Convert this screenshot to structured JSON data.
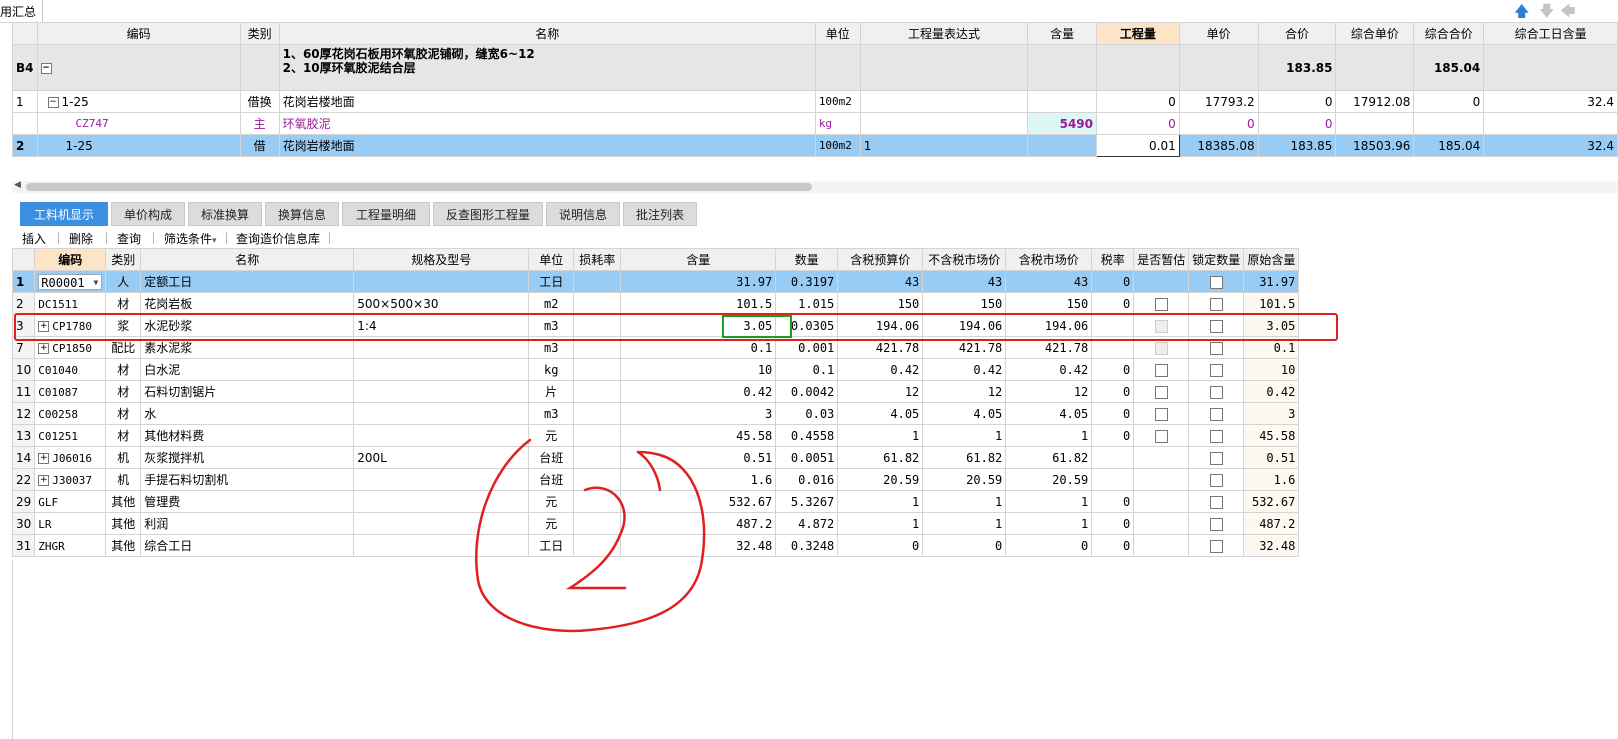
{
  "topbar": {
    "label": "用汇总"
  },
  "upper": {
    "headers": [
      "编码",
      "类别",
      "名称",
      "单位",
      "工程量表达式",
      "含量",
      "工程量",
      "单价",
      "合价",
      "综合单价",
      "综合合价",
      "综合工日含量"
    ],
    "group": {
      "code": "B4",
      "toggle": "−",
      "name_line1": "1、60厚花岗石板用环氧胶泥铺砌，缝宽6~12",
      "name_line2": "2、10厚环氧胶泥结合层",
      "hejia": "183.85",
      "zonghehejia": "185.04"
    },
    "rows": [
      {
        "num": "1",
        "toggle": "−",
        "code": "1-25",
        "type": "借换",
        "name": "花岗岩楼地面",
        "unit": "100m2",
        "expr": "",
        "hl": "",
        "qty": "0",
        "price": "17793.2",
        "total": "0",
        "cprice": "17912.08",
        "ctotal": "0",
        "labor": "32.4"
      },
      {
        "num": "",
        "code": "CZ747",
        "type": "主",
        "name": "环氧胶泥",
        "unit": "kg",
        "expr": "",
        "hl": "5490",
        "qty": "0",
        "price": "0",
        "total": "0",
        "cprice": "",
        "ctotal": "",
        "labor": ""
      },
      {
        "num": "2",
        "code": "1-25",
        "type": "借",
        "name": "花岗岩楼地面",
        "unit": "100m2",
        "expr": "1",
        "hl": "",
        "qty": "0.01",
        "price": "18385.08",
        "total": "183.85",
        "cprice": "18503.96",
        "ctotal": "185.04",
        "labor": "32.4"
      }
    ]
  },
  "tabs": [
    "工料机显示",
    "单价构成",
    "标准换算",
    "换算信息",
    "工程量明细",
    "反查图形工程量",
    "说明信息",
    "批注列表"
  ],
  "toolbar": {
    "insert": "插入",
    "delete": "删除",
    "query": "查询",
    "filter": "筛选条件",
    "filter_caret": "▾",
    "price_lib": "查询造价信息库"
  },
  "lower": {
    "headers": [
      "编码",
      "类别",
      "名称",
      "规格及型号",
      "单位",
      "损耗率",
      "含量",
      "数量",
      "含税预算价",
      "不含税市场价",
      "含税市场价",
      "税率",
      "是否暂估",
      "锁定数量",
      "原始含量"
    ],
    "rows": [
      {
        "num": "1",
        "code": "R00001",
        "type": "人",
        "name": "定额工日",
        "spec": "",
        "unit": "工日",
        "loss": "",
        "hl": "31.97",
        "qty": "0.3197",
        "p1": "43",
        "p2": "43",
        "p3": "43",
        "tax": "0",
        "est": "none",
        "orig": "31.97",
        "plus": false
      },
      {
        "num": "2",
        "code": "DC1511",
        "type": "材",
        "name": "花岗岩板",
        "spec": "500×500×30",
        "unit": "m2",
        "loss": "",
        "hl": "101.5",
        "qty": "1.015",
        "p1": "150",
        "p2": "150",
        "p3": "150",
        "tax": "0",
        "est": "box",
        "orig": "101.5",
        "plus": false
      },
      {
        "num": "3",
        "code": "CP1780",
        "type": "浆",
        "name": "水泥砂浆",
        "spec": "1:4",
        "unit": "m3",
        "loss": "",
        "hl": "3.05",
        "qty": "0.0305",
        "p1": "194.06",
        "p2": "194.06",
        "p3": "194.06",
        "tax": "",
        "est": "dis",
        "orig": "3.05",
        "plus": true
      },
      {
        "num": "7",
        "code": "CP1850",
        "type": "配比",
        "name": "素水泥浆",
        "spec": "",
        "unit": "m3",
        "loss": "",
        "hl": "0.1",
        "qty": "0.001",
        "p1": "421.78",
        "p2": "421.78",
        "p3": "421.78",
        "tax": "",
        "est": "dis",
        "orig": "0.1",
        "plus": true
      },
      {
        "num": "10",
        "code": "C01040",
        "type": "材",
        "name": "白水泥",
        "spec": "",
        "unit": "kg",
        "loss": "",
        "hl": "10",
        "qty": "0.1",
        "p1": "0.42",
        "p2": "0.42",
        "p3": "0.42",
        "tax": "0",
        "est": "box",
        "orig": "10",
        "plus": false
      },
      {
        "num": "11",
        "code": "C01087",
        "type": "材",
        "name": "石料切割锯片",
        "spec": "",
        "unit": "片",
        "loss": "",
        "hl": "0.42",
        "qty": "0.0042",
        "p1": "12",
        "p2": "12",
        "p3": "12",
        "tax": "0",
        "est": "box",
        "orig": "0.42",
        "plus": false
      },
      {
        "num": "12",
        "code": "C00258",
        "type": "材",
        "name": "水",
        "spec": "",
        "unit": "m3",
        "loss": "",
        "hl": "3",
        "qty": "0.03",
        "p1": "4.05",
        "p2": "4.05",
        "p3": "4.05",
        "tax": "0",
        "est": "box",
        "orig": "3",
        "plus": false
      },
      {
        "num": "13",
        "code": "C01251",
        "type": "材",
        "name": "其他材料费",
        "spec": "",
        "unit": "元",
        "loss": "",
        "hl": "45.58",
        "qty": "0.4558",
        "p1": "1",
        "p2": "1",
        "p3": "1",
        "tax": "0",
        "est": "box",
        "orig": "45.58",
        "plus": false
      },
      {
        "num": "14",
        "code": "J06016",
        "type": "机",
        "name": "灰浆搅拌机",
        "spec": "200L",
        "unit": "台班",
        "loss": "",
        "hl": "0.51",
        "qty": "0.0051",
        "p1": "61.82",
        "p2": "61.82",
        "p3": "61.82",
        "tax": "",
        "est": "none",
        "orig": "0.51",
        "plus": true
      },
      {
        "num": "22",
        "code": "J30037",
        "type": "机",
        "name": "手提石料切割机",
        "spec": "",
        "unit": "台班",
        "loss": "",
        "hl": "1.6",
        "qty": "0.016",
        "p1": "20.59",
        "p2": "20.59",
        "p3": "20.59",
        "tax": "",
        "est": "none",
        "orig": "1.6",
        "plus": true
      },
      {
        "num": "29",
        "code": "GLF",
        "type": "其他",
        "name": "管理费",
        "spec": "",
        "unit": "元",
        "loss": "",
        "hl": "532.67",
        "qty": "5.3267",
        "p1": "1",
        "p2": "1",
        "p3": "1",
        "tax": "0",
        "est": "none",
        "orig": "532.67",
        "plus": false
      },
      {
        "num": "30",
        "code": "LR",
        "type": "其他",
        "name": "利润",
        "spec": "",
        "unit": "元",
        "loss": "",
        "hl": "487.2",
        "qty": "4.872",
        "p1": "1",
        "p2": "1",
        "p3": "1",
        "tax": "0",
        "est": "none",
        "orig": "487.2",
        "plus": false
      },
      {
        "num": "31",
        "code": "ZHGR",
        "type": "其他",
        "name": "综合工日",
        "spec": "",
        "unit": "工日",
        "loss": "",
        "hl": "32.48",
        "qty": "0.3248",
        "p1": "0",
        "p2": "0",
        "p3": "0",
        "tax": "0",
        "est": "none",
        "orig": "32.48",
        "plus": false
      }
    ]
  },
  "colors": {
    "selected_row": "#99ccf5",
    "active_tab": "#3b8fe0",
    "annotation_red": "#e02020",
    "annotation_green": "#1aa01a",
    "highlight_value": "#e00000"
  }
}
